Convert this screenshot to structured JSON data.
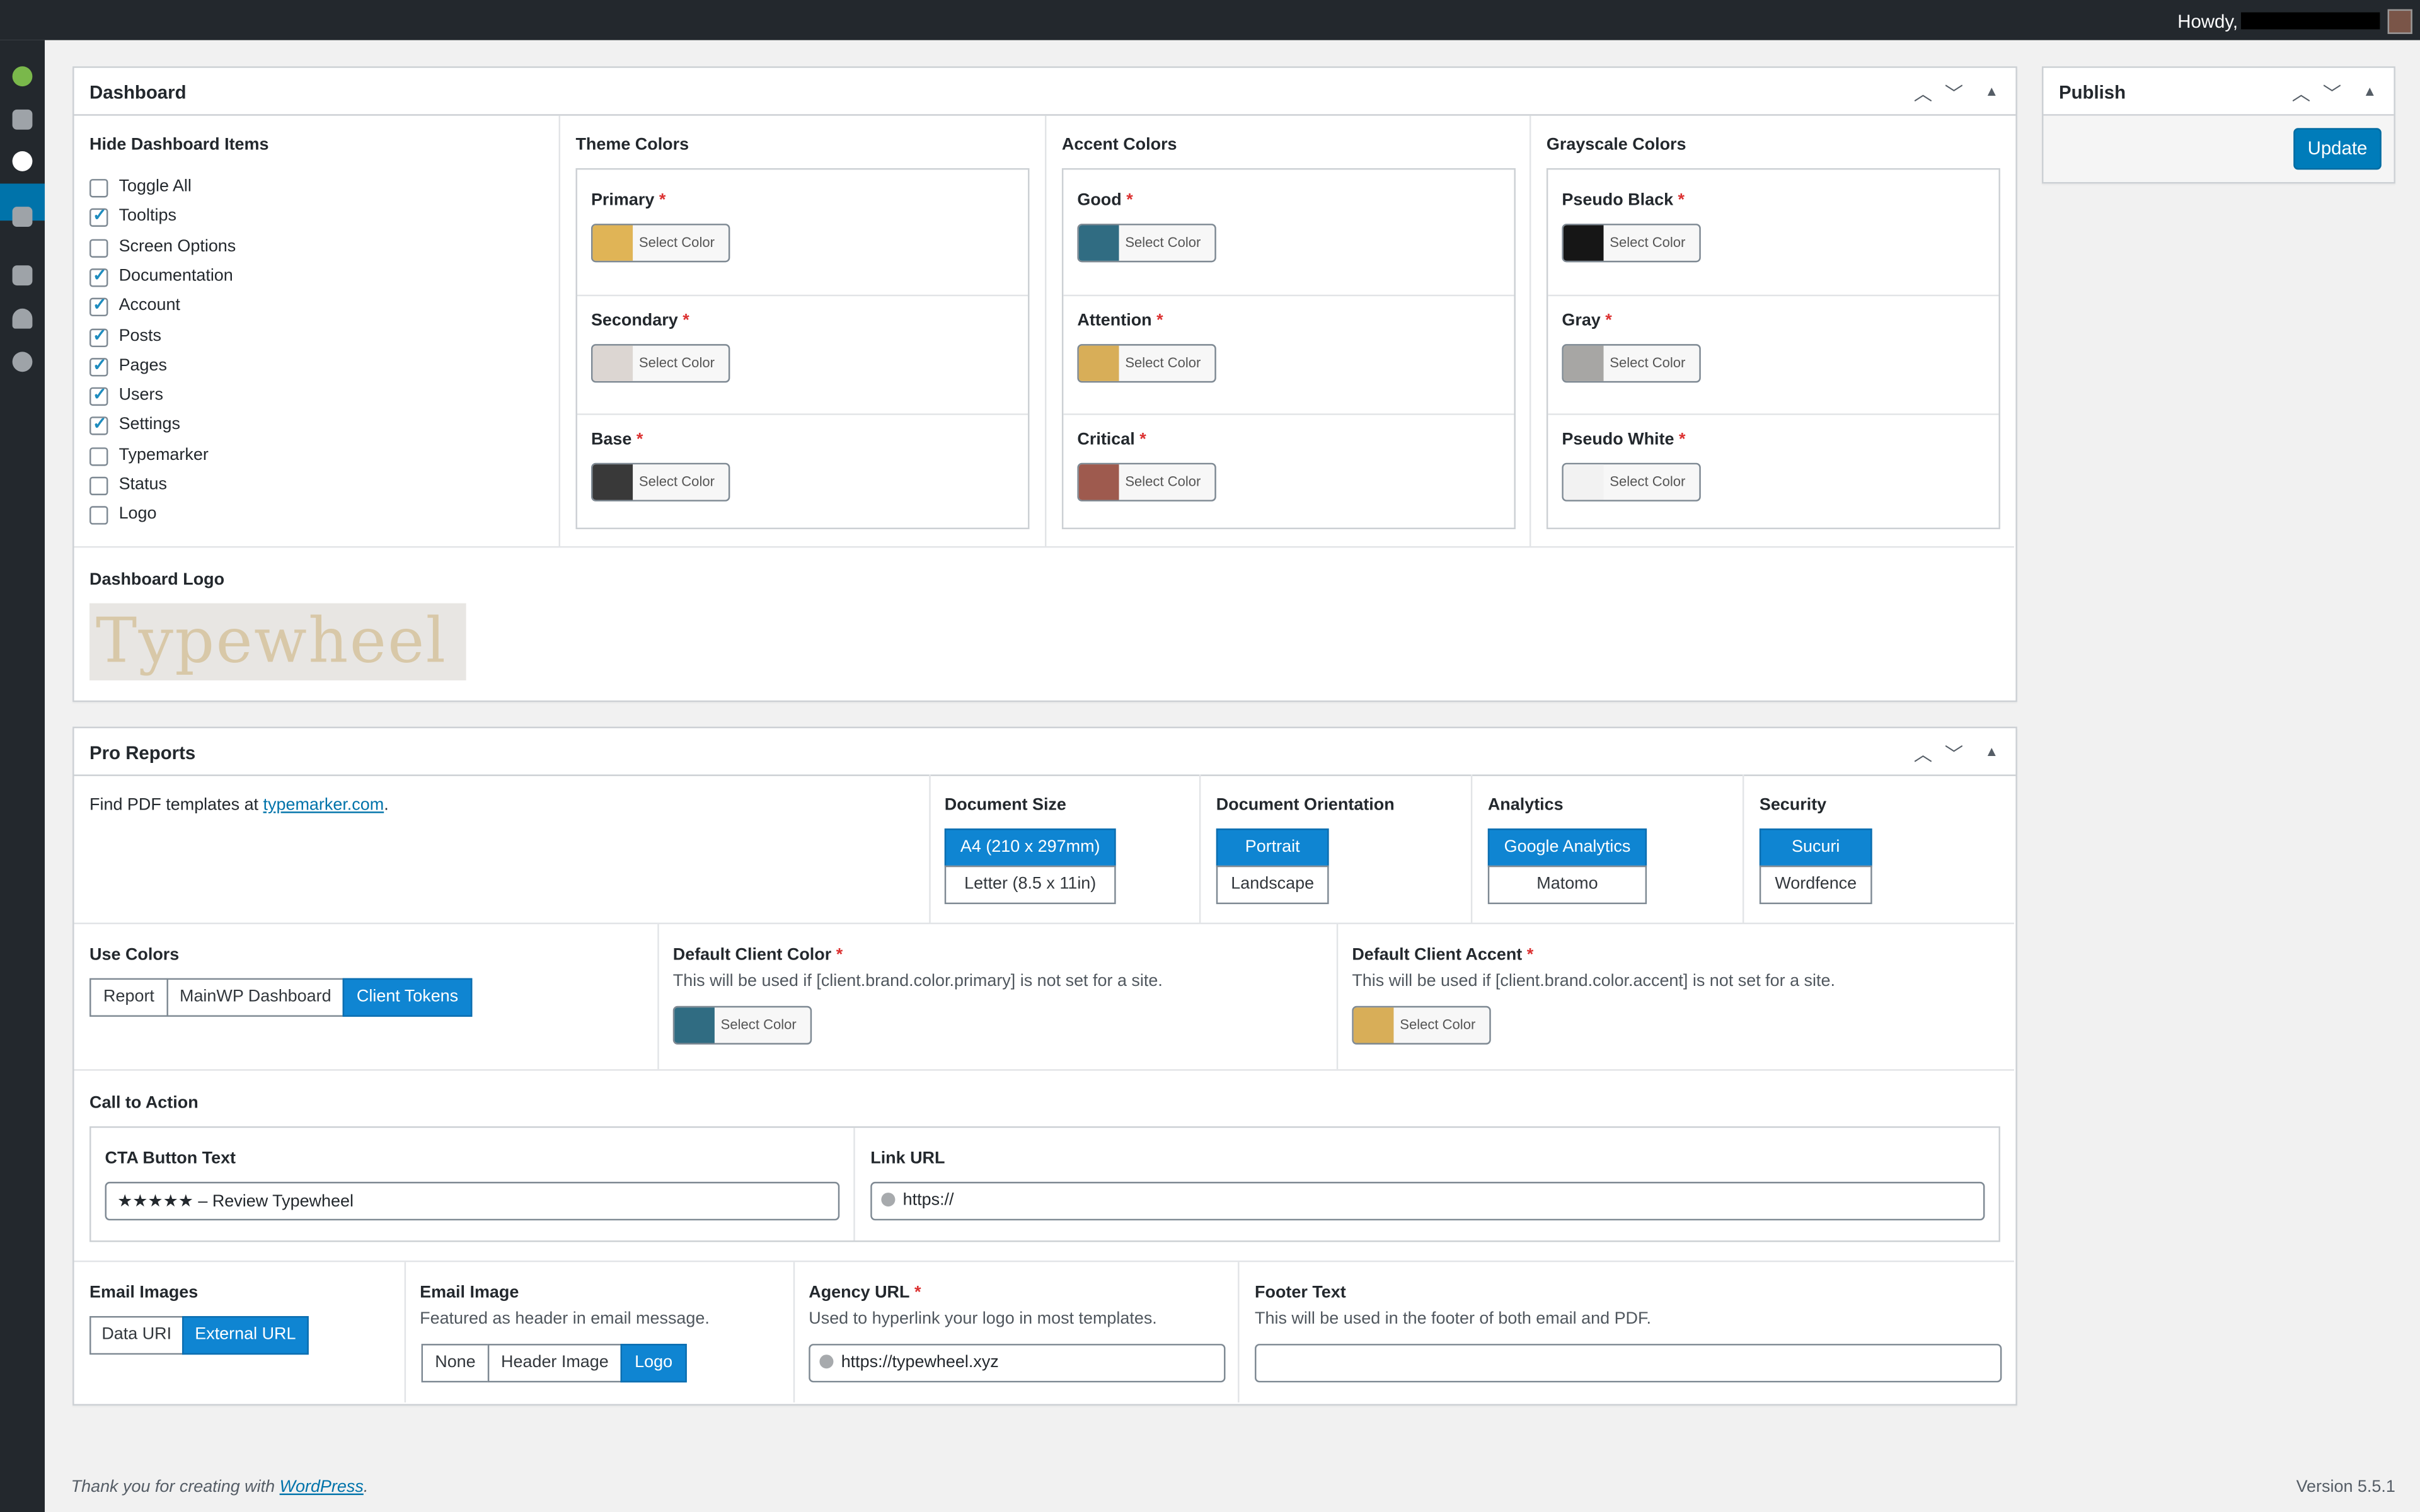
{
  "admin_bar": {
    "howdy": "Howdy,"
  },
  "dashboard": {
    "title": "Dashboard",
    "hide_items": {
      "title": "Hide Dashboard Items",
      "items": [
        {
          "label": "Toggle All",
          "checked": false
        },
        {
          "label": "Tooltips",
          "checked": true
        },
        {
          "label": "Screen Options",
          "checked": false
        },
        {
          "label": "Documentation",
          "checked": true
        },
        {
          "label": "Account",
          "checked": true
        },
        {
          "label": "Posts",
          "checked": true
        },
        {
          "label": "Pages",
          "checked": true
        },
        {
          "label": "Users",
          "checked": true
        },
        {
          "label": "Settings",
          "checked": true
        },
        {
          "label": "Typemarker",
          "checked": false
        },
        {
          "label": "Status",
          "checked": false
        },
        {
          "label": "Logo",
          "checked": false
        }
      ]
    },
    "theme_colors": {
      "title": "Theme Colors",
      "items": [
        {
          "label": "Primary",
          "color": "#e0b456"
        },
        {
          "label": "Secondary",
          "color": "#dcd6d2"
        },
        {
          "label": "Base",
          "color": "#393939"
        }
      ]
    },
    "accent_colors": {
      "title": "Accent Colors",
      "items": [
        {
          "label": "Good",
          "color": "#306c82"
        },
        {
          "label": "Attention",
          "color": "#d8ae58"
        },
        {
          "label": "Critical",
          "color": "#9e5a4e"
        }
      ]
    },
    "grayscale_colors": {
      "title": "Grayscale Colors",
      "items": [
        {
          "label": "Pseudo Black",
          "color": "#161616"
        },
        {
          "label": "Gray",
          "color": "#a7a6a4"
        },
        {
          "label": "Pseudo White",
          "color": "#f2f2f2"
        }
      ]
    },
    "select_color": "Select Color",
    "required_mark": "*",
    "logo": {
      "title": "Dashboard Logo",
      "text": "Typewheel"
    }
  },
  "publish": {
    "title": "Publish",
    "update_label": "Update"
  },
  "pro_reports": {
    "title": "Pro Reports",
    "intro_prefix": "Find PDF templates at ",
    "intro_link": "typemarker.com",
    "intro_suffix": ".",
    "document_size": {
      "title": "Document Size",
      "options": [
        "A4 (210 x 297mm)",
        "Letter (8.5 x 11in)"
      ],
      "selected": "A4 (210 x 297mm)"
    },
    "document_orientation": {
      "title": "Document Orientation",
      "options": [
        "Portrait",
        "Landscape"
      ],
      "selected": "Portrait"
    },
    "analytics": {
      "title": "Analytics",
      "options": [
        "Google Analytics",
        "Matomo"
      ],
      "selected": "Google Analytics"
    },
    "security": {
      "title": "Security",
      "options": [
        "Sucuri",
        "Wordfence"
      ],
      "selected": "Sucuri"
    },
    "use_colors": {
      "title": "Use Colors",
      "options": [
        "Report",
        "MainWP Dashboard",
        "Client Tokens"
      ],
      "selected": "Client Tokens"
    },
    "default_client_color": {
      "title": "Default Client Color",
      "desc": "This will be used if [client.brand.color.primary] is not set for a site.",
      "color": "#306c82"
    },
    "default_client_accent": {
      "title": "Default Client Accent",
      "desc": "This will be used if [client.brand.color.accent] is not set for a site.",
      "color": "#d8ae58"
    },
    "cta": {
      "title": "Call to Action",
      "button_text_label": "CTA Button Text",
      "button_text_value": "★★★★★ – Review Typewheel",
      "link_url_label": "Link URL",
      "link_url_value": "https://"
    },
    "email_images": {
      "title": "Email Images",
      "options": [
        "Data URI",
        "External URL"
      ],
      "selected": "External URL"
    },
    "email_image": {
      "title": "Email Image",
      "desc": "Featured as header in email message.",
      "options": [
        "None",
        "Header Image",
        "Logo"
      ],
      "selected": "Logo"
    },
    "agency_url": {
      "title": "Agency URL",
      "desc": "Used to hyperlink your logo in most templates.",
      "value": "https://typewheel.xyz"
    },
    "footer_text": {
      "title": "Footer Text",
      "desc": "This will be used in the footer of both email and PDF.",
      "value": ""
    }
  },
  "footer": {
    "thanks_prefix": "Thank you for creating with ",
    "thanks_link": "WordPress",
    "thanks_suffix": ".",
    "version": "Version 5.5.1"
  },
  "colors": {
    "accent": "#0073aa",
    "segment_on": "#0f85d2",
    "admin_bar": "#23282d"
  }
}
